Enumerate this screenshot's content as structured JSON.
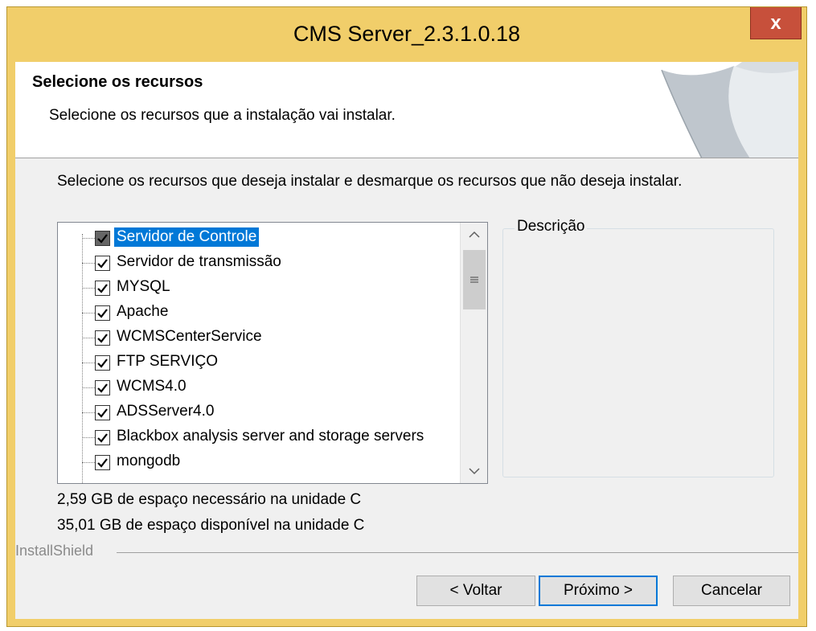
{
  "window": {
    "title": "CMS Server_2.3.1.0.18",
    "close_label": "x"
  },
  "header": {
    "title": "Selecione os recursos",
    "subtitle": "Selecione os recursos que a instalação vai instalar."
  },
  "instruction": "Selecione os recursos que deseja instalar e desmarque os recursos que não deseja instalar.",
  "features": [
    {
      "label": "Servidor de Controle",
      "checked": true,
      "partial": true,
      "selected": true
    },
    {
      "label": "Servidor de transmissão",
      "checked": true
    },
    {
      "label": "MYSQL",
      "checked": true
    },
    {
      "label": "Apache",
      "checked": true
    },
    {
      "label": "WCMSCenterService",
      "checked": true
    },
    {
      "label": "FTP SERVIÇO",
      "checked": true
    },
    {
      "label": "WCMS4.0",
      "checked": true
    },
    {
      "label": "ADSServer4.0",
      "checked": true
    },
    {
      "label": "Blackbox analysis server and storage servers",
      "checked": true
    },
    {
      "label": "mongodb",
      "checked": true
    }
  ],
  "description": {
    "label": "Descrição"
  },
  "space": {
    "required": "2,59 GB de espaço necessário na unidade C",
    "available": "35,01 GB de espaço disponível na unidade C"
  },
  "brand": "InstallShield",
  "buttons": {
    "back": "< Voltar",
    "next": "Próximo >",
    "cancel": "Cancelar"
  },
  "colors": {
    "frame": "#f1ce6a",
    "close": "#c7503b",
    "selection": "#0078d7"
  },
  "icons": {
    "close": "close-icon",
    "scroll_up": "chevron-up-icon",
    "scroll_down": "chevron-down-icon",
    "checkbox": "checkbox-icon"
  }
}
